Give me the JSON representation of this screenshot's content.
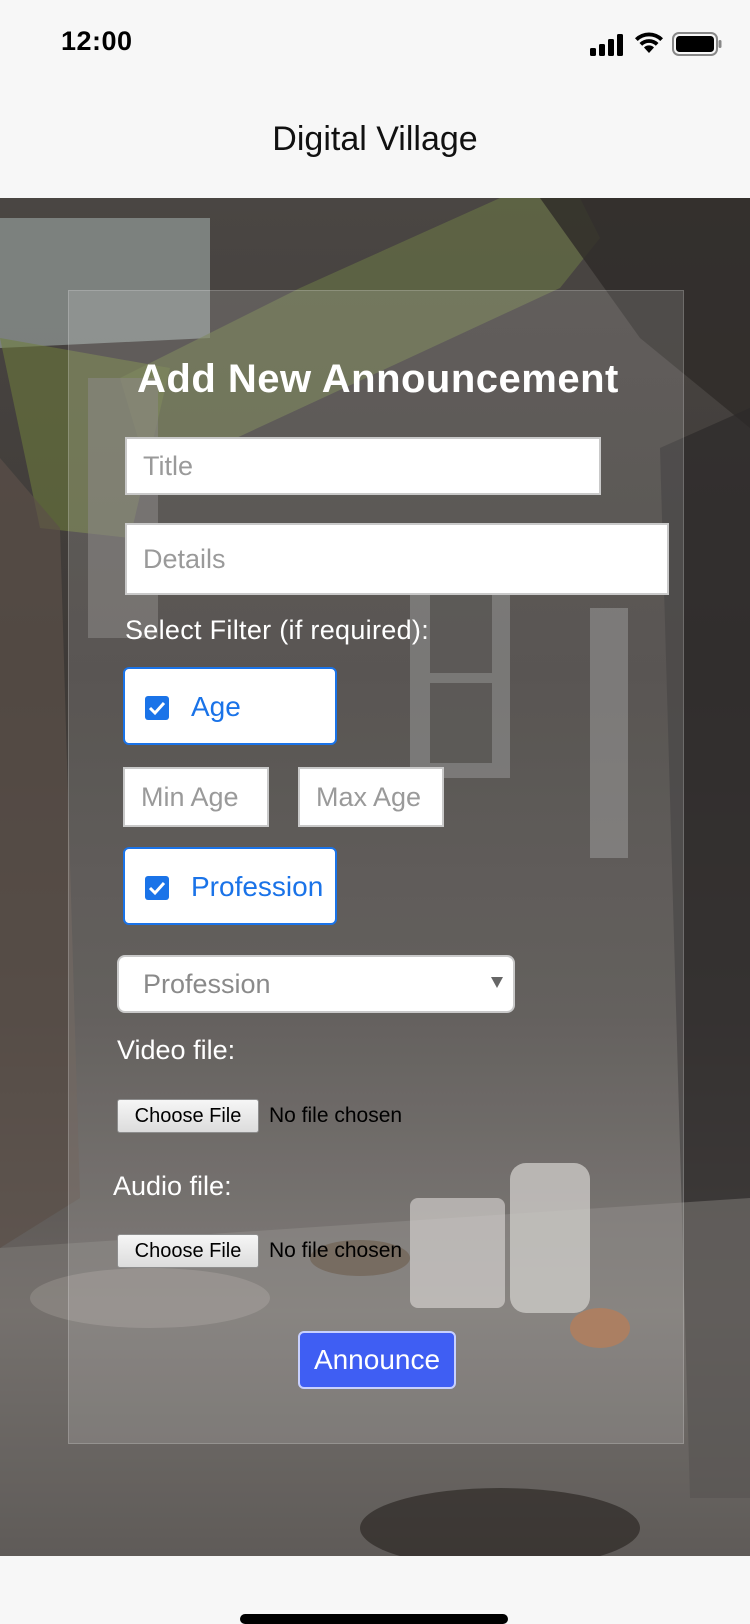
{
  "status_bar": {
    "time": "12:00",
    "icons": [
      "signal-icon",
      "wifi-icon",
      "battery-icon"
    ]
  },
  "header": {
    "title": "Digital Village"
  },
  "form": {
    "title": "Add New Announcement",
    "title_placeholder": "Title",
    "details_placeholder": "Details",
    "filter_label": "Select Filter (if required):",
    "age_filter": {
      "label": "Age",
      "checked": true
    },
    "min_age_placeholder": "Min Age",
    "max_age_placeholder": "Max Age",
    "profession_filter": {
      "label": "Profession",
      "checked": true
    },
    "profession_select": {
      "selected": "Profession"
    },
    "video": {
      "label": "Video file:",
      "button": "Choose File",
      "status": "No file chosen"
    },
    "audio": {
      "label": "Audio file:",
      "button": "Choose File",
      "status": "No file chosen"
    },
    "submit_label": "Announce"
  },
  "colors": {
    "accent": "#1a73e8",
    "submit": "#3f5ef3",
    "bar_background": "#f7f7f7"
  }
}
